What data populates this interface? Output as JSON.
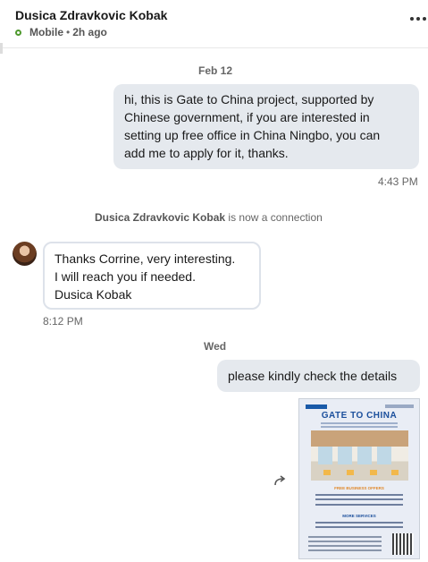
{
  "header": {
    "contact_name": "Dusica Zdravkovic Kobak",
    "status_device": "Mobile",
    "status_separator": "•",
    "status_time": "2h ago",
    "more_icon": "ellipsis-icon"
  },
  "messages": {
    "date_1": "Feb 12",
    "msg_1_lines": [
      "hi, this is Gate to China project, supported by",
      "Chinese government, if you are interested in",
      "setting up free office in China Ningbo, you can",
      "add me to apply for it, thanks."
    ],
    "msg_1_time": "4:43 PM",
    "connection_name": "Dusica Zdravkovic Kobak",
    "connection_text": "is now a connection",
    "msg_2_lines": [
      "Thanks Corrine, very interesting.",
      "I will reach you if needed.",
      "Dusica Kobak"
    ],
    "msg_2_time": "8:12 PM",
    "date_2": "Wed",
    "msg_3_text": "please kindly check the details",
    "forward_icon": "share-arrow-icon",
    "attachment": {
      "title": "GATE TO CHINA",
      "offers_heading": "FREE BUSINESS OFFERS",
      "more_heading": "MORE SERVICES"
    }
  },
  "colors": {
    "outgoing_bubble": "#e5e9ee",
    "incoming_border": "#dde2ea",
    "online_dot": "#4f9a2f",
    "poster_blue": "#1b4f9c"
  }
}
